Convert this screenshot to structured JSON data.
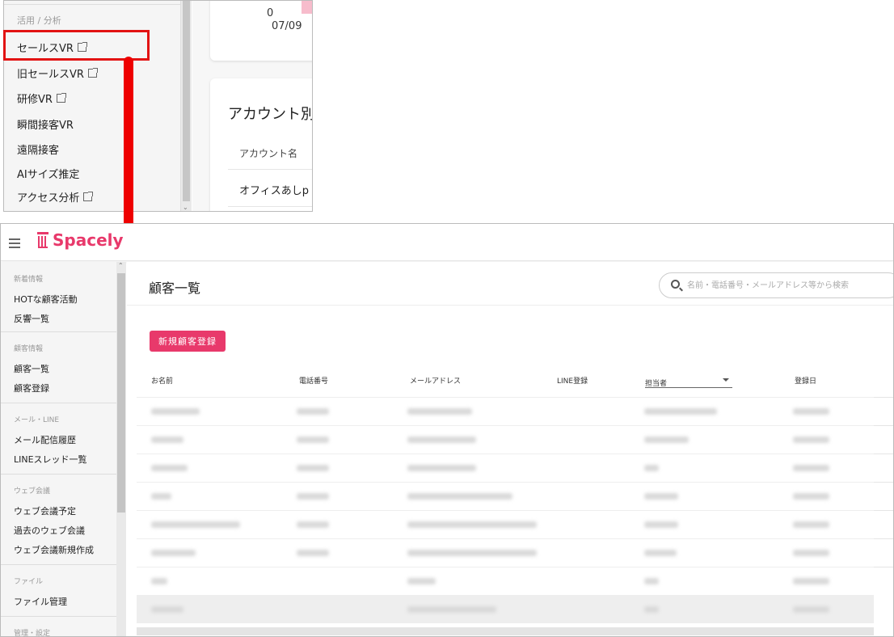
{
  "top_panel": {
    "section_title": "活用 / 分析",
    "items": [
      {
        "label": "セールスVR",
        "external": true
      },
      {
        "label": "旧セールスVR",
        "external": true
      },
      {
        "label": "研修VR",
        "external": true
      },
      {
        "label": "瞬間接客VR",
        "external": false
      },
      {
        "label": "遠隔接客",
        "external": false
      },
      {
        "label": "AIサイズ推定",
        "external": false
      },
      {
        "label": "アクセス分析",
        "external": true
      }
    ],
    "card_value": "0",
    "card_date": "07/09",
    "account_card_title": "アカウント別",
    "account_col_header": "アカウント名",
    "account_row": "オフィスあしp"
  },
  "header": {
    "logo": "Spacely"
  },
  "sidebar": {
    "sections": [
      {
        "caption": "新着情報",
        "items": [
          "HOTな顧客活動",
          "反響一覧"
        ]
      },
      {
        "caption": "顧客情報",
        "items": [
          "顧客一覧",
          "顧客登録"
        ]
      },
      {
        "caption": "メール・LINE",
        "items": [
          "メール配信履歴",
          "LINEスレッド一覧"
        ]
      },
      {
        "caption": "ウェブ会議",
        "items": [
          "ウェブ会議予定",
          "過去のウェブ会議",
          "ウェブ会議新規作成"
        ]
      },
      {
        "caption": "ファイル",
        "items": [
          "ファイル管理"
        ]
      },
      {
        "caption": "管理・設定",
        "items": []
      }
    ]
  },
  "main": {
    "title": "顧客一覧",
    "search_placeholder": "名前・電話番号・メールアドレス等から検索",
    "new_button": "新規顧客登録",
    "columns": {
      "name": "お名前",
      "phone": "電話番号",
      "email": "メールアドレス",
      "line": "LINE登録",
      "owner": "担当者",
      "registered": "登録日"
    }
  },
  "colors": {
    "accent": "#e8396b",
    "annotation": "#ee0000"
  }
}
